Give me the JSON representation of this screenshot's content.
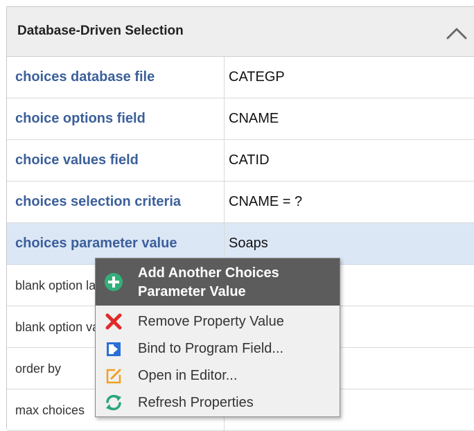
{
  "section": {
    "title": "Database-Driven Selection",
    "collapse_icon": "chevron-up-icon"
  },
  "properties": [
    {
      "name": "choices database file",
      "value": "CATEGP"
    },
    {
      "name": "choice options field",
      "value": "CNAME"
    },
    {
      "name": "choice values field",
      "value": "CATID"
    },
    {
      "name": "choices selection criteria",
      "value": "CNAME = ?"
    },
    {
      "name": "choices parameter value",
      "value": "Soaps"
    },
    {
      "name": "blank option label",
      "value": ""
    },
    {
      "name": "blank option value",
      "value": ""
    },
    {
      "name": "order by",
      "value": ""
    },
    {
      "name": "max choices",
      "value": ""
    }
  ],
  "context_menu": {
    "items": [
      {
        "line1": "Add Another Choices",
        "line2": "Parameter Value",
        "icon": "plus-circle-icon",
        "highlighted": true
      },
      {
        "label": "Remove Property Value",
        "icon": "red-x-icon"
      },
      {
        "label": "Bind to Program Field...",
        "icon": "bind-field-icon"
      },
      {
        "label": "Open in Editor...",
        "icon": "edit-pencil-icon"
      },
      {
        "label": "Refresh Properties",
        "icon": "refresh-icon"
      }
    ]
  },
  "colors": {
    "set_property_name": "#3b5f9a",
    "selected_row_bg": "#dce7f6",
    "menu_highlight_bg": "#5c5c5c",
    "add_icon": "#33b07a",
    "remove_icon": "#e02a2a",
    "bind_icon": "#2a6fd6",
    "edit_icon": "#f0a020",
    "refresh_icon": "#2aa57a"
  }
}
